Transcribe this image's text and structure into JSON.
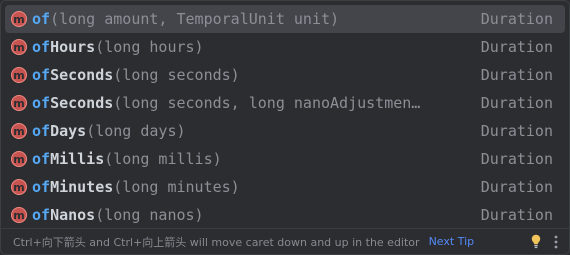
{
  "items": [
    {
      "match": "of",
      "rest": "",
      "params": "(long amount, TemporalUnit unit)",
      "type": "Duration",
      "icon": "method-icon",
      "icon_letter": "m"
    },
    {
      "match": "of",
      "rest": "Hours",
      "params": "(long hours)",
      "type": "Duration",
      "icon": "method-icon",
      "icon_letter": "m"
    },
    {
      "match": "of",
      "rest": "Seconds",
      "params": "(long seconds)",
      "type": "Duration",
      "icon": "method-icon",
      "icon_letter": "m"
    },
    {
      "match": "of",
      "rest": "Seconds",
      "params": "(long seconds, long nanoAdjustmen…",
      "type": "Duration",
      "icon": "method-icon",
      "icon_letter": "m"
    },
    {
      "match": "of",
      "rest": "Days",
      "params": "(long days)",
      "type": "Duration",
      "icon": "method-icon",
      "icon_letter": "m"
    },
    {
      "match": "of",
      "rest": "Millis",
      "params": "(long millis)",
      "type": "Duration",
      "icon": "method-icon",
      "icon_letter": "m"
    },
    {
      "match": "of",
      "rest": "Minutes",
      "params": "(long minutes)",
      "type": "Duration",
      "icon": "method-icon",
      "icon_letter": "m"
    },
    {
      "match": "of",
      "rest": "Nanos",
      "params": "(long nanos)",
      "type": "Duration",
      "icon": "method-icon",
      "icon_letter": "m"
    }
  ],
  "footer": {
    "tip": "Ctrl+向下箭头 and Ctrl+向上箭头 will move caret down and up in the editor",
    "next_tip": "Next Tip",
    "bulb_icon": "lightbulb-icon",
    "more_icon": "more-vertical-icon"
  },
  "colors": {
    "background": "#2b2d30",
    "selected_row": "#43454a",
    "match_highlight": "#56a8f5",
    "method_icon": "#c75450",
    "link": "#548af7",
    "bulb": "#f2c55c"
  }
}
